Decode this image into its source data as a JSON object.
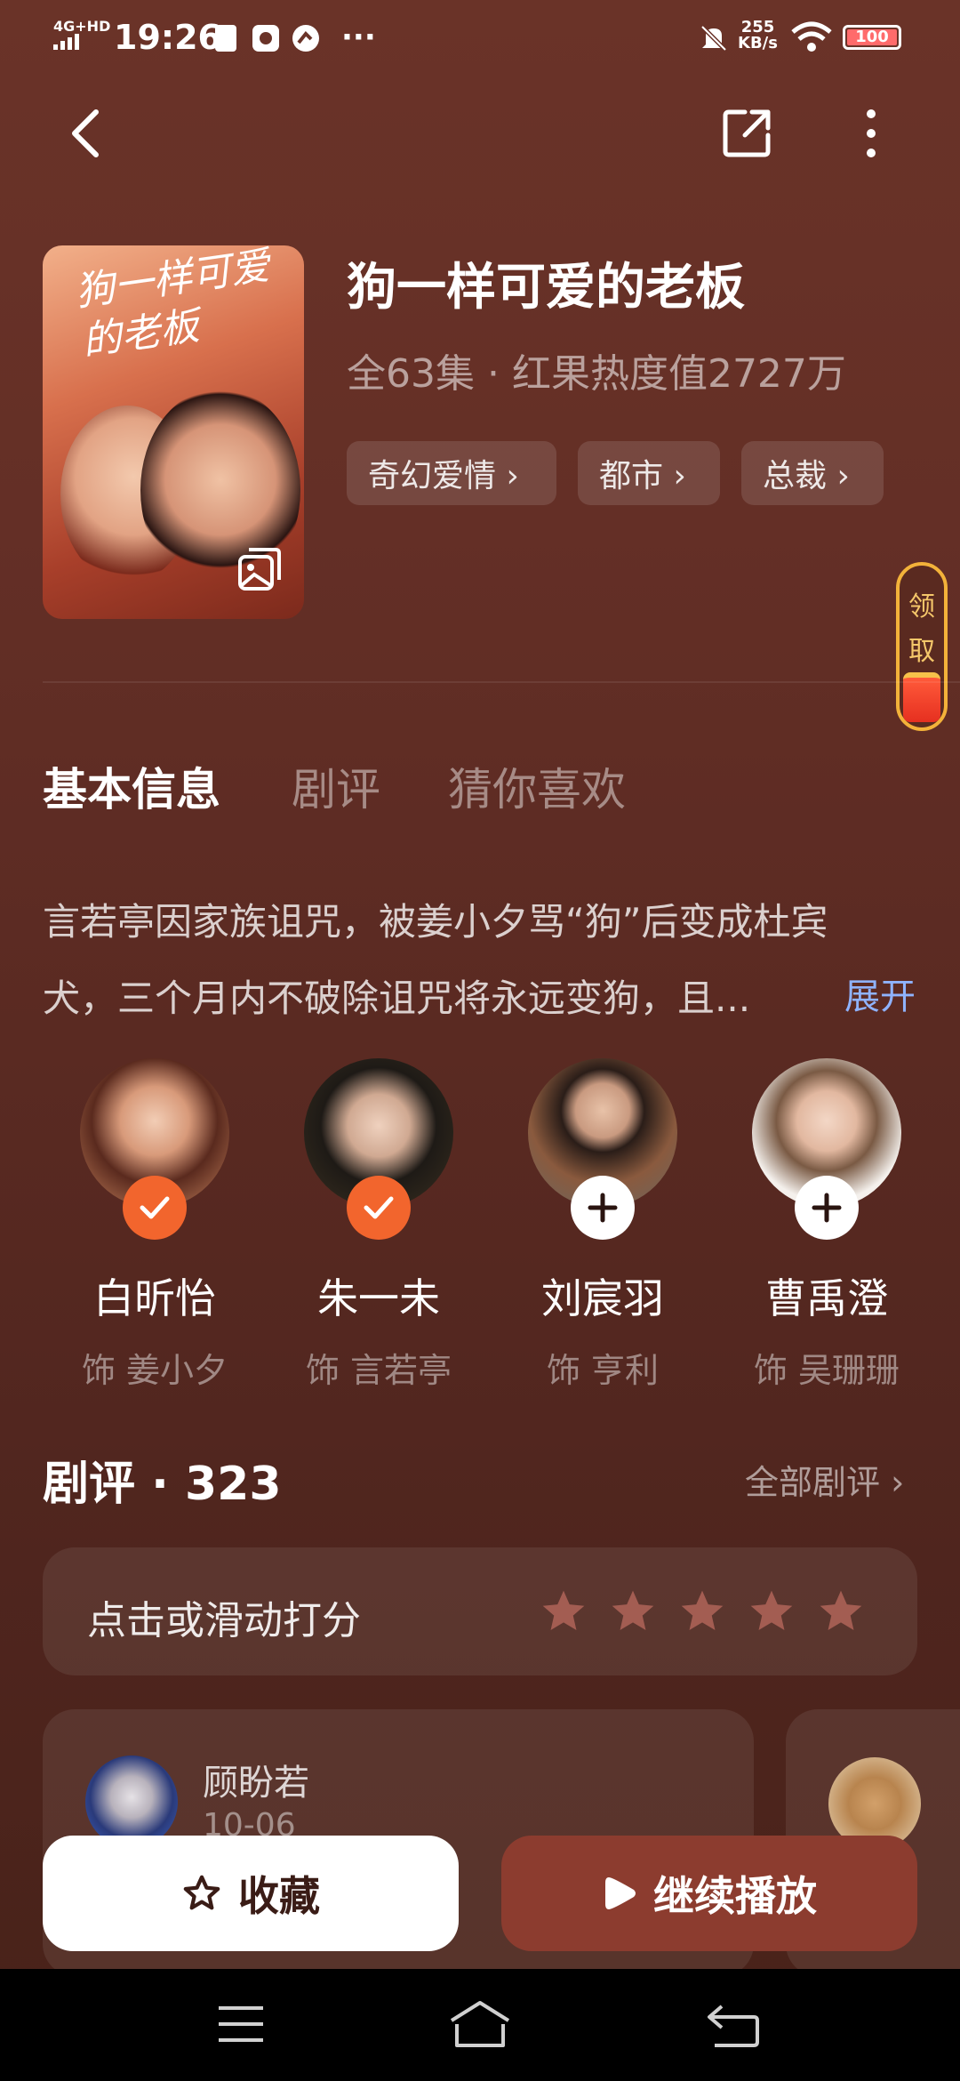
{
  "status": {
    "time": "19:26",
    "signal": "4G+HD",
    "net_speed_value": "255",
    "net_speed_unit": "KB/s",
    "battery": "100"
  },
  "drama": {
    "title": "狗一样可爱的老板",
    "meta": "全63集 · 红果热度值2727万",
    "poster_title": "狗一样可爱的老板",
    "tags": [
      "奇幻爱情 ›",
      "都市 ›",
      "总裁 ›"
    ]
  },
  "reward": {
    "label_1": "领",
    "label_2": "取"
  },
  "tabs": [
    "基本信息",
    "剧评",
    "猜你喜欢"
  ],
  "description": "言若亭因家族诅咒，被姜小夕骂“狗”后变成杜宾犬，三个月内不破除诅咒将永远变狗，且...",
  "expand_label": "展开",
  "cast": [
    {
      "name": "白昕怡",
      "role": "饰 姜小夕",
      "followed": true
    },
    {
      "name": "朱一未",
      "role": "饰 言若亭",
      "followed": true
    },
    {
      "name": "刘宸羽",
      "role": "饰 亨利",
      "followed": false
    },
    {
      "name": "曹禹澄",
      "role": "饰 吴珊珊",
      "followed": false
    }
  ],
  "reviews": {
    "heading": "剧评 · 323",
    "all_label": "全部剧评 ›",
    "rate_prompt": "点击或滑动打分",
    "first_user": "顾盼若",
    "first_date": "10-06"
  },
  "actions": {
    "favorite": "收藏",
    "play": "继续播放"
  },
  "colors": {
    "accent_orange": "#f2652d",
    "play_button": "#8c3c2f",
    "link_blue": "#8fb3ff"
  }
}
